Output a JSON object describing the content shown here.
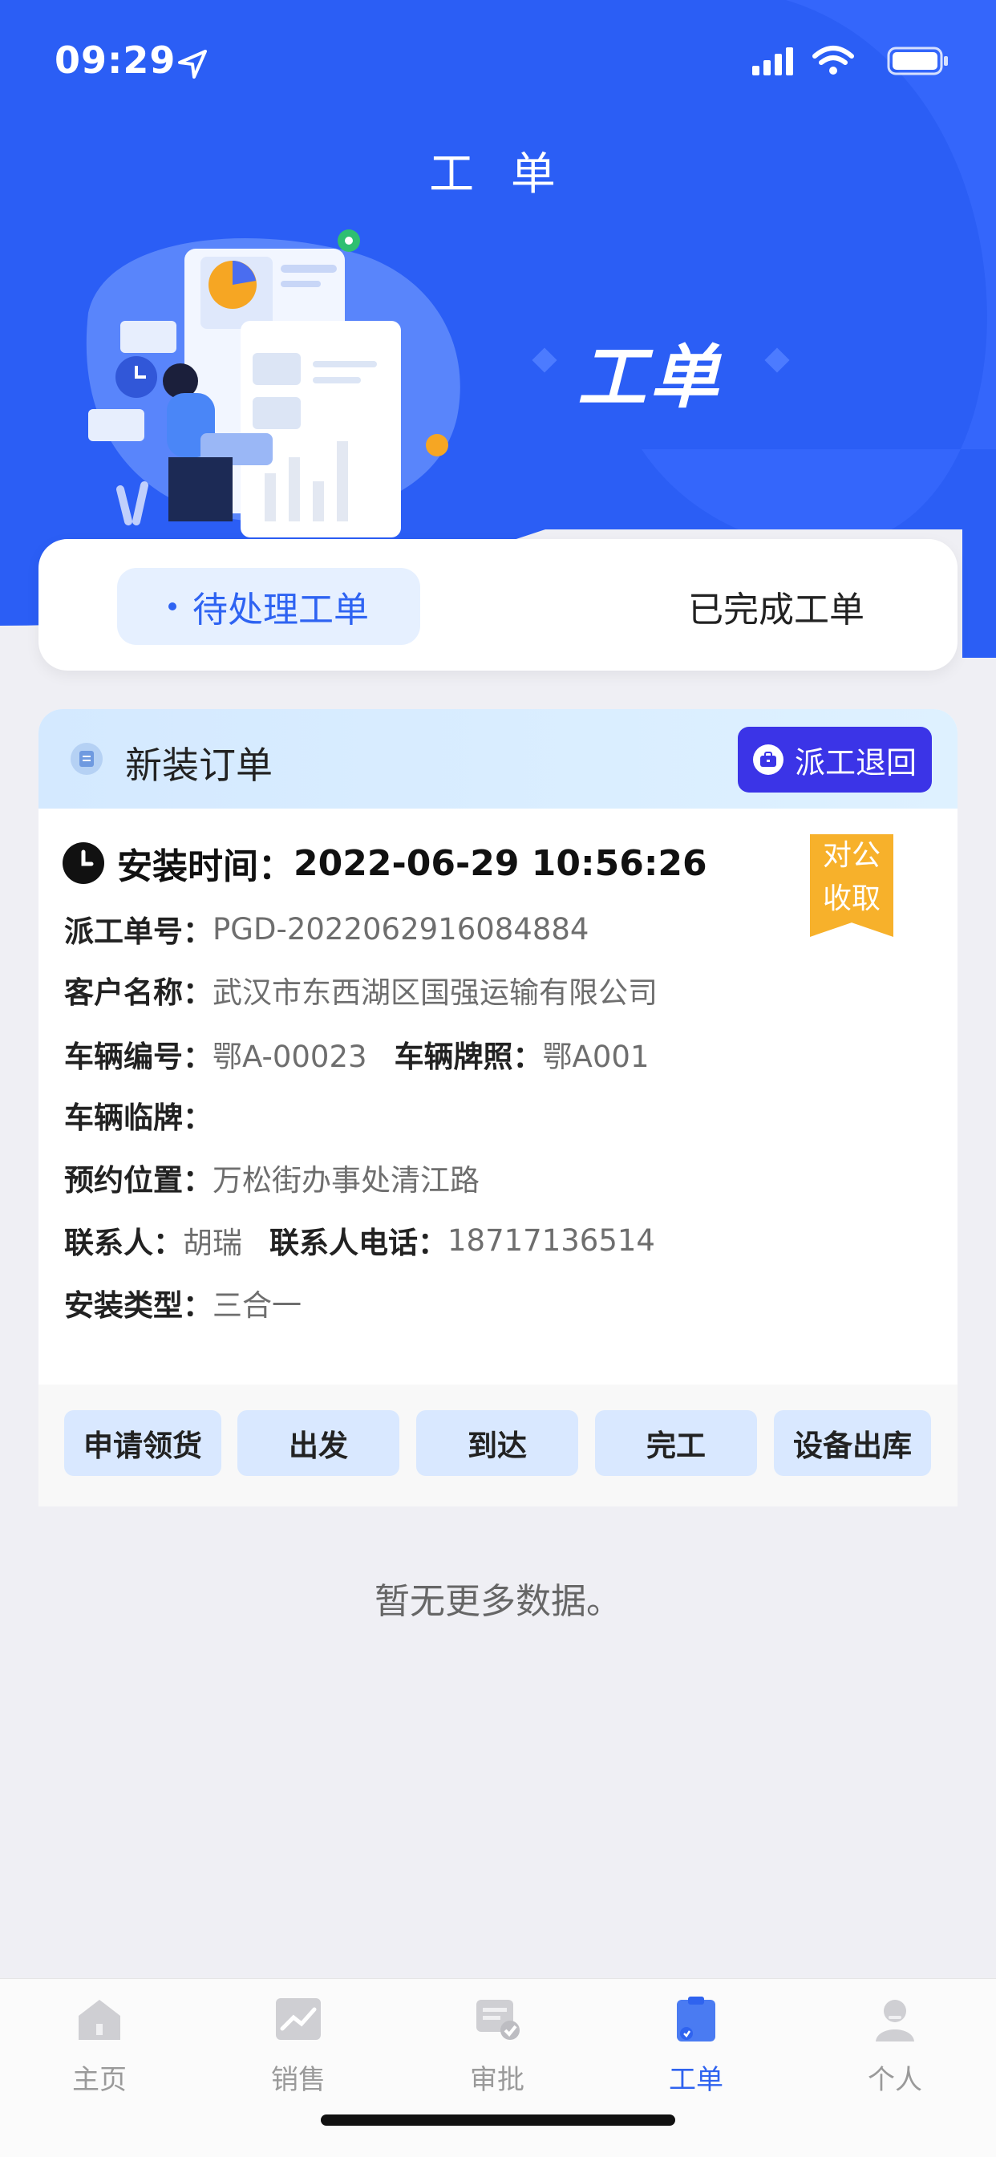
{
  "status_bar": {
    "time": "09:29"
  },
  "header": {
    "title": "工 单",
    "hero_text": "工单"
  },
  "tabs": [
    {
      "label": "待处理工单",
      "active": true
    },
    {
      "label": "已完成工单",
      "active": false
    }
  ],
  "order": {
    "type_title": "新装订单",
    "return_button": "派工退回",
    "install_time_label": "安装时间：",
    "install_time_value": "2022-06-29 10:56:26",
    "ribbon": {
      "line1": "对公",
      "line2": "收取",
      "color": "#f7b12b"
    },
    "fields": {
      "dispatch_no_label": "派工单号：",
      "dispatch_no": "PGD-2022062916084884",
      "customer_label": "客户名称：",
      "customer": "武汉市东西湖区国强运输有限公司",
      "vehicle_no_label": "车辆编号：",
      "vehicle_no": "鄂A-00023",
      "plate_label": "车辆牌照：",
      "plate": "鄂A001",
      "temp_plate_label": "车辆临牌：",
      "temp_plate": "",
      "location_label": "预约位置：",
      "location": "万松街办事处清江路",
      "contact_label": "联系人：",
      "contact": "胡瑞",
      "phone_label": "联系人电话：",
      "phone": "18717136514",
      "install_type_label": "安装类型：",
      "install_type": "三合一"
    },
    "actions": [
      "申请领货",
      "出发",
      "到达",
      "完工",
      "设备出库"
    ]
  },
  "empty_text": "暂无更多数据。",
  "bottom_nav": [
    {
      "label": "主页",
      "icon": "home-icon",
      "active": false
    },
    {
      "label": "销售",
      "icon": "sales-chart-icon",
      "active": false
    },
    {
      "label": "审批",
      "icon": "approval-icon",
      "active": false
    },
    {
      "label": "工单",
      "icon": "clipboard-icon",
      "active": true
    },
    {
      "label": "个人",
      "icon": "person-icon",
      "active": false
    }
  ],
  "colors": {
    "primary": "#2e63f2",
    "return_button": "#3b34e7",
    "ribbon": "#f7b12b"
  }
}
